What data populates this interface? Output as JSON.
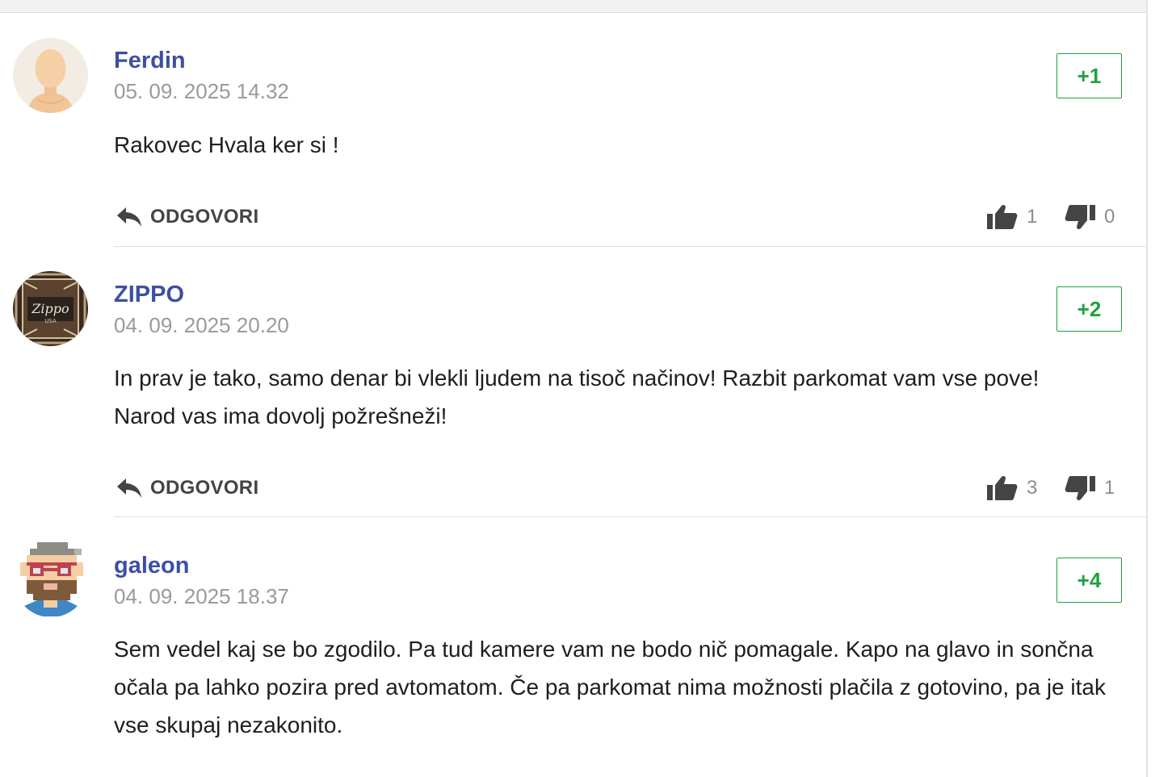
{
  "comments": [
    {
      "author": "Ferdin",
      "date": "05. 09. 2025 14.32",
      "score": "+1",
      "text": "Rakovec Hvala ker si !",
      "reply_label": "ODGOVORI",
      "likes": "1",
      "dislikes": "0",
      "avatar": "default-person-avatar"
    },
    {
      "author": "ZIPPO",
      "date": "04. 09. 2025 20.20",
      "score": "+2",
      "text": "In prav je tako, samo denar bi vlekli ljudem na tisoč načinov! Razbit parkomat vam vse pove! Narod vas ima dovolj požrešneži!",
      "reply_label": "ODGOVORI",
      "likes": "3",
      "dislikes": "1",
      "avatar": "zippo-lighter-avatar",
      "avatar_text": "Zippo",
      "avatar_subtext": "USA"
    },
    {
      "author": "galeon",
      "date": "04. 09. 2025 18.37",
      "score": "+4",
      "text": "Sem vedel kaj se bo zgodilo. Pa tud kamere vam ne bodo nič pomagale. Kapo na glavo in sončna očala pa lahko pozira pred avtomatom. Če pa parkomat nima možnosti plačila z gotovino, pa je itak vse skupaj nezakonito.",
      "avatar": "pixel-bearded-man-avatar"
    }
  ],
  "colors": {
    "author": "#3d4fa3",
    "score": "#21a142",
    "date": "#9a9a9a",
    "icon": "#444444"
  },
  "icons": {
    "reply": "reply-arrow-icon",
    "like": "thumbs-up-icon",
    "dislike": "thumbs-down-icon"
  }
}
